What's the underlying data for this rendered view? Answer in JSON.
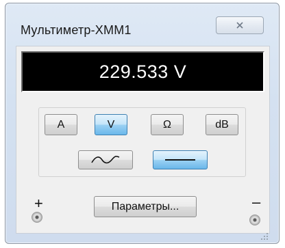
{
  "window": {
    "title": "Мультиметр-XMM1",
    "close_icon": "close-x-icon"
  },
  "display": {
    "reading": "229.533 V"
  },
  "modes": {
    "buttons": [
      {
        "key": "ammeter",
        "label": "A",
        "active": false
      },
      {
        "key": "voltmeter",
        "label": "V",
        "active": true
      },
      {
        "key": "ohmmeter",
        "label": "Ω",
        "active": false
      },
      {
        "key": "decibel",
        "label": "dB",
        "active": false
      }
    ]
  },
  "signal": {
    "ac_icon": "sine-wave-icon",
    "dc_icon": "dc-line-icon",
    "selected": "dc"
  },
  "params": {
    "label": "Параметры..."
  },
  "terminals": {
    "positive": "+",
    "negative": "–"
  },
  "colors": {
    "display_bg": "#000000",
    "display_text": "#ffffff",
    "active_button": "#9bd1f3",
    "window_frame": "#d4e1f1"
  }
}
